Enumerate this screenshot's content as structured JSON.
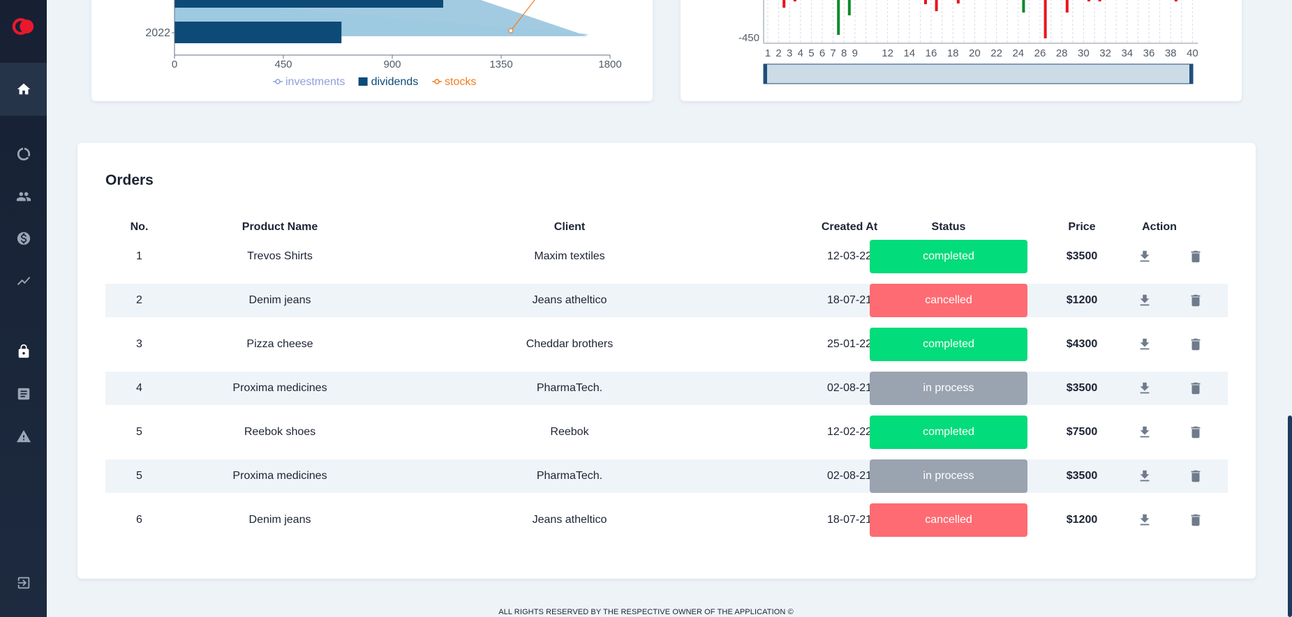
{
  "sidebar": {
    "logo": "logo-icon",
    "items": [
      {
        "icon": "home-icon",
        "active": true
      },
      {
        "icon": "pie-chart-icon"
      },
      {
        "icon": "users-icon"
      },
      {
        "icon": "dollar-icon"
      },
      {
        "icon": "trending-icon"
      },
      {
        "icon": "lock-icon"
      },
      {
        "icon": "document-icon"
      },
      {
        "icon": "warning-icon"
      },
      {
        "icon": "logout-icon"
      }
    ]
  },
  "chart_data": [
    {
      "type": "bar",
      "orientation": "horizontal",
      "visible_categories": [
        "2022"
      ],
      "series": [
        {
          "name": "investments",
          "type": "area",
          "color": "#9dc8e0"
        },
        {
          "name": "dividends",
          "type": "bar",
          "color": "#0d4a78",
          "values": [
            {
              "category": "2022",
              "value": 690
            }
          ]
        },
        {
          "name": "stocks",
          "type": "line",
          "color": "#f47c1f",
          "values": [
            {
              "category": "2022",
              "value": 1390
            }
          ]
        }
      ],
      "x_ticks": [
        "0",
        "450",
        "900",
        "1350",
        "1800"
      ],
      "xlim": [
        0,
        1800
      ],
      "legend": [
        "investments",
        "dividends",
        "stocks"
      ],
      "legend_placement": "bottom",
      "legend_colors": {
        "investments": "#8fa0dc",
        "dividends": "#0d4a78",
        "stocks": "#f47c1f"
      }
    },
    {
      "type": "bar",
      "y_tick_label": "-450",
      "x_ticks": [
        "1",
        "2",
        "3",
        "4",
        "5",
        "6",
        "7",
        "8",
        "9",
        "12",
        "14",
        "16",
        "18",
        "20",
        "22",
        "24",
        "26",
        "28",
        "30",
        "32",
        "34",
        "36",
        "38",
        "40"
      ],
      "colors": {
        "positive": "#0a8a2a",
        "negative": "#e8141c"
      },
      "has_range_slider": true
    }
  ],
  "orders": {
    "title": "Orders",
    "columns": [
      "No.",
      "Product Name",
      "Client",
      "Created At",
      "Status",
      "Price",
      "Action"
    ],
    "rows": [
      {
        "no": "1",
        "product": "Trevos Shirts",
        "client": "Maxim textiles",
        "created": "12-03-22",
        "status": "completed",
        "price": "$3500"
      },
      {
        "no": "2",
        "product": "Denim jeans",
        "client": "Jeans atheltico",
        "created": "18-07-21",
        "status": "cancelled",
        "price": "$1200"
      },
      {
        "no": "3",
        "product": "Pizza cheese",
        "client": "Cheddar brothers",
        "created": "25-01-22",
        "status": "completed",
        "price": "$4300"
      },
      {
        "no": "4",
        "product": "Proxima medicines",
        "client": "PharmaTech.",
        "created": "02-08-21",
        "status": "in process",
        "price": "$3500"
      },
      {
        "no": "5",
        "product": "Reebok shoes",
        "client": "Reebok",
        "created": "12-02-22",
        "status": "completed",
        "price": "$7500"
      },
      {
        "no": "5",
        "product": "Proxima medicines",
        "client": "PharmaTech.",
        "created": "02-08-21",
        "status": "in process",
        "price": "$3500"
      },
      {
        "no": "6",
        "product": "Denim jeans",
        "client": "Jeans atheltico",
        "created": "18-07-21",
        "status": "cancelled",
        "price": "$1200"
      }
    ],
    "status_colors": {
      "completed": "#03dc7a",
      "cancelled": "#ff6b72",
      "in process": "#9aa3b0"
    },
    "action_icons": [
      "download-icon",
      "trash-icon"
    ]
  },
  "footer": {
    "text": "ALL RIGHTS RESERVED BY THE RESPECTIVE OWNER OF THE APPLICATION ©"
  }
}
